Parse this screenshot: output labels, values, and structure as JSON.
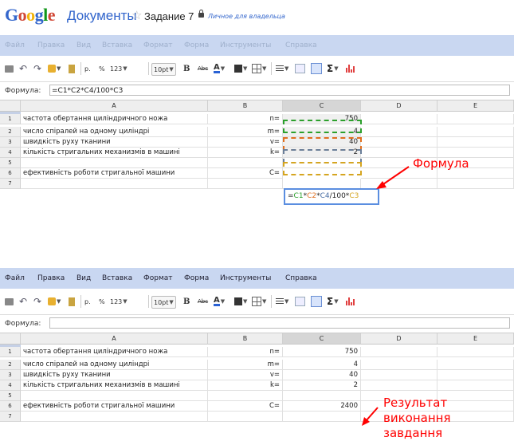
{
  "header": {
    "logo": "Google",
    "product": "Документы",
    "doc_name": "Задание 7",
    "privacy": "Личное для владельца"
  },
  "menu": [
    "Файл",
    "Правка",
    "Вид",
    "Вставка",
    "Формат",
    "Форма",
    "Инструменты",
    "Справка"
  ],
  "toolbar": {
    "currency": "р.",
    "percent": "%",
    "number_fmt": "123",
    "font_size": "10pt",
    "bold": "B",
    "strike": "Abc",
    "text_color": "A",
    "sigma": "Σ"
  },
  "formula_label": "Формула:",
  "top_formula_value": "=C1*C2*C4/100*C3",
  "bottom_formula_value": "",
  "columns": [
    "A",
    "B",
    "C",
    "D",
    "E"
  ],
  "rows": [
    {
      "num": "1",
      "a": "частота обертання циліндричного ножа",
      "b": "n=",
      "c": "750"
    },
    {
      "num": "2",
      "a": "число спіралей на одному циліндрі",
      "b": "m=",
      "c": "4"
    },
    {
      "num": "3",
      "a": "швидкість руху тканини",
      "b": "v=",
      "c": "40"
    },
    {
      "num": "4",
      "a": "кількість стригальних механизмів в машині",
      "b": "k=",
      "c": "2"
    },
    {
      "num": "5",
      "a": "",
      "b": "",
      "c": ""
    },
    {
      "num": "6",
      "a": "ефективність роботи стригальної машини",
      "b": "C=",
      "c": "2400"
    },
    {
      "num": "7",
      "a": "",
      "b": "",
      "c": ""
    }
  ],
  "editor_tokens": [
    "=",
    "C1",
    "*",
    "C2",
    "*",
    "C4",
    "/100*",
    "C3"
  ],
  "annotations": {
    "formula": "Формула",
    "result": [
      "Результат",
      "виконання",
      "завдання"
    ]
  },
  "colors": {
    "annotation": "#ff0000",
    "menubar": "#c9d7f1",
    "accent": "#3366cc"
  }
}
